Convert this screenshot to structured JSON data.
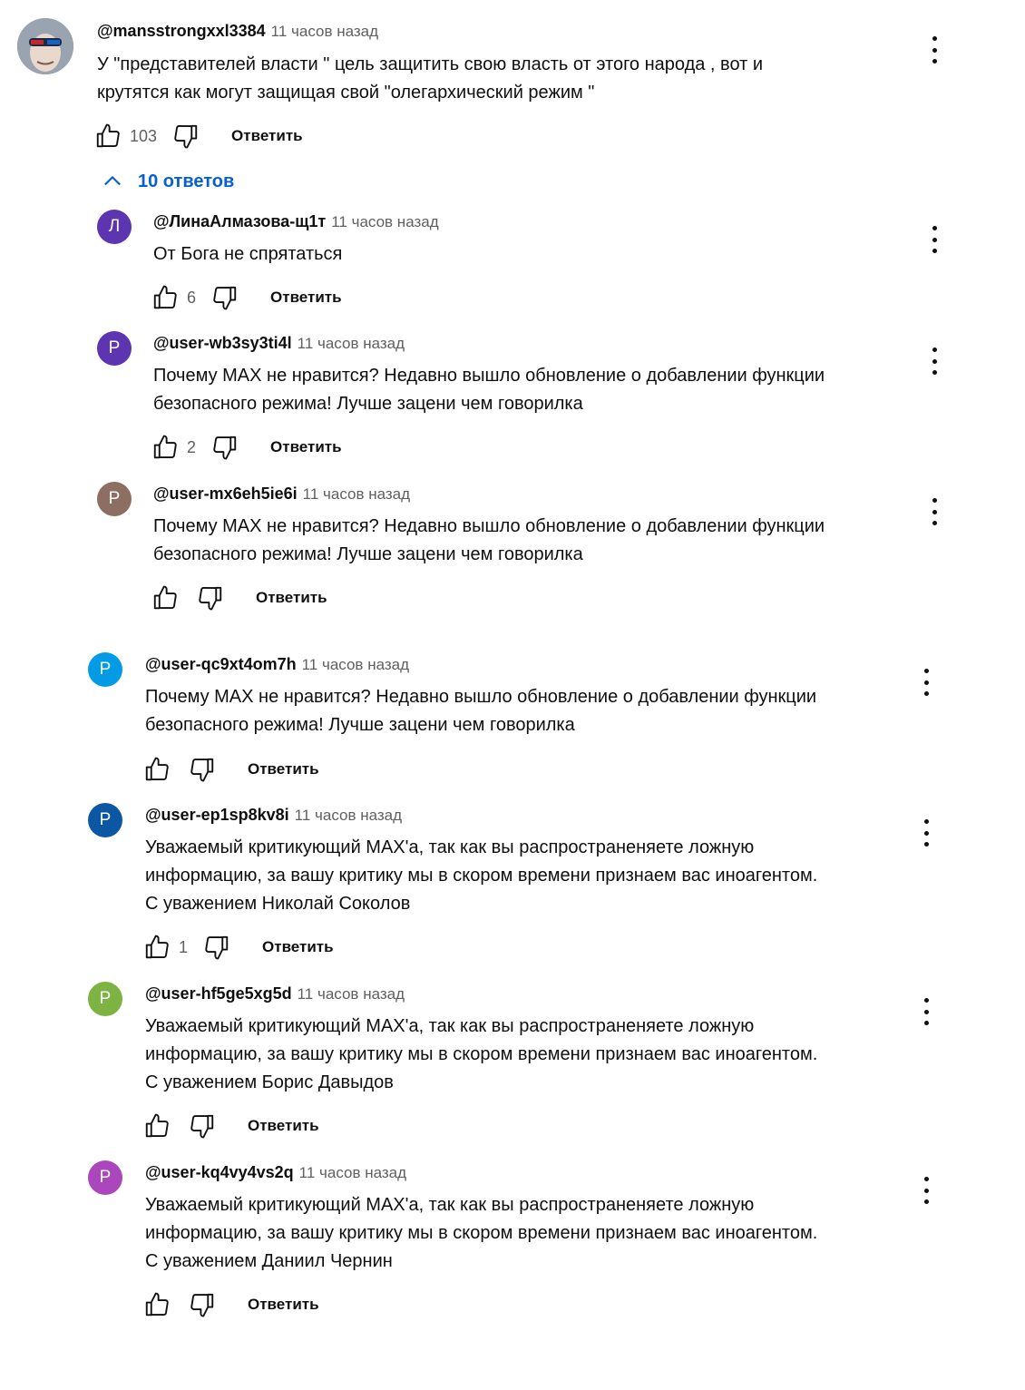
{
  "thread": {
    "replies_toggle": "10 ответов",
    "reply_label": "Ответить",
    "comment": {
      "author": "@mansstrongxxl3384",
      "time": "11 часов назад",
      "text": "У \"представителей власти \" цель защитить свою власть от этого  народа  , вот и\nкрутятся как могут защищая свой \"олегархический режим \"",
      "likes": "103"
    },
    "replies": [
      {
        "author": "@ЛинаАлмазова-щ1т",
        "time": "11 часов назад",
        "text": "От Бога не спрятаться",
        "likes": "6",
        "avatar_letter": "Л",
        "avatar_color": "#5e35b1"
      },
      {
        "author": "@user-wb3sy3ti4l",
        "time": "11 часов назад",
        "text": "Почему МАХ не нравится? Недавно вышло обновление о добавлении функции\nбезопасного режима! Лучше зацени чем говорилка",
        "likes": "2",
        "avatar_letter": "Р",
        "avatar_color": "#5e35b1"
      },
      {
        "author": "@user-mx6eh5ie6i",
        "time": "11 часов назад",
        "text": "Почему МАХ не нравится? Недавно вышло обновление о добавлении функции\nбезопасного режима! Лучше зацени чем говорилка",
        "likes": "",
        "avatar_letter": "Р",
        "avatar_color": "#8d6e63"
      },
      {
        "author": "@user-qc9xt4om7h",
        "time": "11 часов назад",
        "text": "Почему МАХ не нравится? Недавно вышло обновление о добавлении функции\nбезопасного режима! Лучше зацени чем говорилка",
        "likes": "",
        "avatar_letter": "Р",
        "avatar_color": "#039be5"
      },
      {
        "author": "@user-ep1sp8kv8i",
        "time": "11 часов назад",
        "text": "Уважаемый критикующий МАХ'а, так как вы распространеняете ложную\nинформацию, за вашу критику мы в скором времени признаем вас иноагентом.\nС уважением Николай Соколов",
        "likes": "1",
        "avatar_letter": "Р",
        "avatar_color": "#0b57a4"
      },
      {
        "author": "@user-hf5ge5xg5d",
        "time": "11 часов назад",
        "text": "Уважаемый критикующий МАХ'а, так как вы распространеняете ложную\nинформацию, за вашу критику мы в скором времени признаем вас иноагентом.\nС уважением Борис Давыдов",
        "likes": "",
        "avatar_letter": "Р",
        "avatar_color": "#7cb342"
      },
      {
        "author": "@user-kq4vy4vs2q",
        "time": "11 часов назад",
        "text": "Уважаемый критикующий МАХ'а, так как вы распространеняете ложную\nинформацию, за вашу критику мы в скором времени признаем вас иноагентом.\nС уважением Даниил Чернин",
        "likes": "",
        "avatar_letter": "Р",
        "avatar_color": "#ab47bc"
      }
    ]
  },
  "icons": {
    "like": "thumbs-up-icon",
    "dislike": "thumbs-down-icon",
    "menu": "more-vertical-icon",
    "toggle": "chevron-up-icon"
  }
}
